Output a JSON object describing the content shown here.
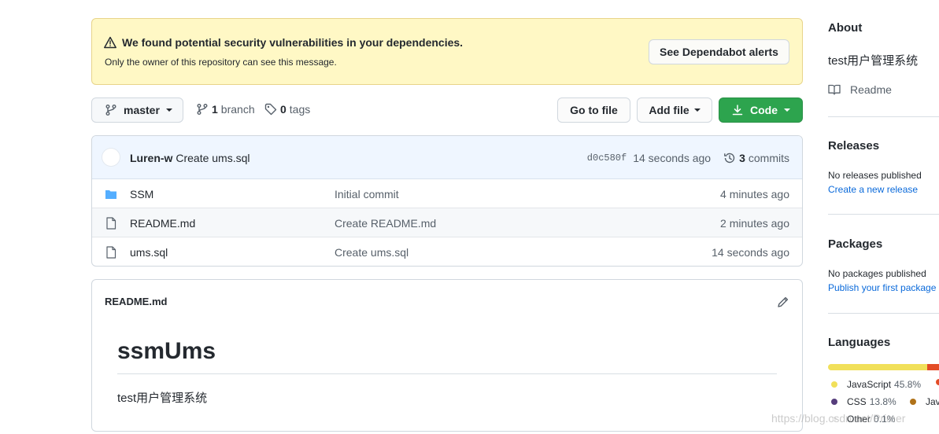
{
  "alert": {
    "title": "We found potential security vulnerabilities in your dependencies.",
    "subtitle": "Only the owner of this repository can see this message.",
    "button": "See Dependabot alerts"
  },
  "branchbar": {
    "branch_name": "master",
    "branch_count": "1",
    "branch_label": "branch",
    "tag_count": "0",
    "tag_label": "tags",
    "goto_file": "Go to file",
    "add_file": "Add file",
    "code": "Code"
  },
  "commit": {
    "author": "Luren-w",
    "message": "Create ums.sql",
    "sha": "d0c580f",
    "time": "14 seconds ago",
    "count": "3",
    "count_label": "commits"
  },
  "files": [
    {
      "name": "SSM",
      "type": "folder",
      "commit": "Initial commit",
      "age": "4 minutes ago"
    },
    {
      "name": "README.md",
      "type": "file",
      "commit": "Create README.md",
      "age": "2 minutes ago"
    },
    {
      "name": "ums.sql",
      "type": "file",
      "commit": "Create ums.sql",
      "age": "14 seconds ago"
    }
  ],
  "readme": {
    "label": "README.md",
    "heading": "ssmUms",
    "body": "test用户管理系统"
  },
  "sidebar": {
    "about_title": "About",
    "description": "test用户管理系统",
    "readme_link": "Readme",
    "releases_title": "Releases",
    "releases_text": "No releases published",
    "releases_link": "Create a new release",
    "packages_title": "Packages",
    "packages_text": "No packages published",
    "packages_link": "Publish your first package",
    "languages_title": "Languages",
    "languages": [
      {
        "name": "JavaScript",
        "percent": "45.8%",
        "color": "#f1e05a",
        "fraction": 0.458
      },
      {
        "name": "CSS",
        "percent": "13.8%",
        "color": "#563d7c",
        "fraction": 0.138
      },
      {
        "name": "Other",
        "percent": "0.1%",
        "color": "#ededed",
        "fraction": 0.001
      }
    ],
    "languages_extra": [
      {
        "name": "Jav",
        "color": "#b07219"
      }
    ],
    "bar_second_color": "#e34c26"
  },
  "watermark": "https://blog.csdn.net/Primer"
}
